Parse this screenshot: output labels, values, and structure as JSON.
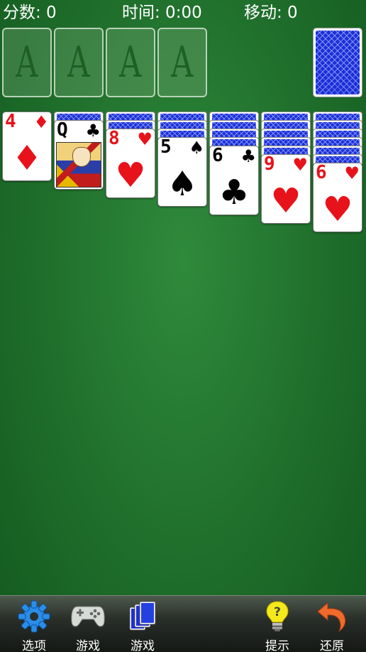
{
  "status": {
    "score": "分数: 0",
    "time": "时间: 0:00",
    "moves": "移动: 0"
  },
  "foundations": [
    "A",
    "A",
    "A",
    "A"
  ],
  "tableau": [
    {
      "hidden": 0,
      "rank": "4",
      "suit": "♦",
      "color": "red"
    },
    {
      "hidden": 1,
      "rank": "Q",
      "suit": "♣",
      "color": "black",
      "face_card": true
    },
    {
      "hidden": 2,
      "rank": "8",
      "suit": "♥",
      "color": "red"
    },
    {
      "hidden": 3,
      "rank": "5",
      "suit": "♠",
      "color": "black"
    },
    {
      "hidden": 4,
      "rank": "6",
      "suit": "♣",
      "color": "black"
    },
    {
      "hidden": 5,
      "rank": "9",
      "suit": "♥",
      "color": "red"
    },
    {
      "hidden": 6,
      "rank": "6",
      "suit": "♥",
      "color": "red"
    }
  ],
  "toolbar": {
    "options": "选项",
    "game": "游戏",
    "deal": "游戏",
    "hint": "提示",
    "undo": "还原"
  },
  "colors": {
    "felt": "#1f6e2b",
    "card_back": "#1d2fd6",
    "red_suit": "#e8121a"
  }
}
